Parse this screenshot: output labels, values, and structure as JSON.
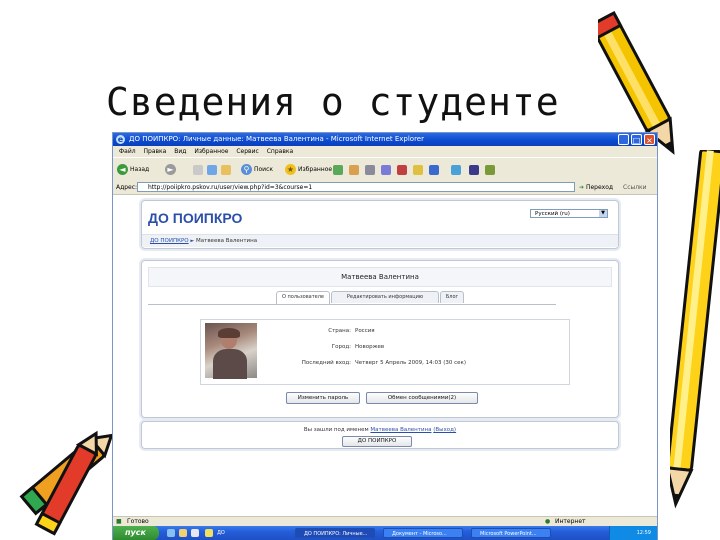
{
  "slide": {
    "title": "Сведения о студенте"
  },
  "window": {
    "title": "ДО ПОИПКРО: Личные данные: Матвеева Валентина - Microsoft Internet Explorer"
  },
  "menu": [
    "Файл",
    "Правка",
    "Вид",
    "Избранное",
    "Сервис",
    "Справка"
  ],
  "toolbar": {
    "back": "Назад",
    "search": "Поиск",
    "favorites": "Избранное"
  },
  "address": {
    "label": "Адрес:",
    "url": "http://poiipkro.pskov.ru/user/view.php?id=3&course=1",
    "go": "Переход",
    "links": "Ссылки"
  },
  "site": {
    "title": "ДО ПОИПКРО",
    "language": "Русский (ru)",
    "breadcrumb": {
      "home": "ДО ПОИПКРО",
      "separator": "►",
      "current": "Матвеева Валентина"
    }
  },
  "profile": {
    "name": "Матвеева Валентина",
    "tabs": [
      "О пользователе",
      "Редактировать информацию",
      "Блог"
    ],
    "fields": [
      {
        "label": "Страна:",
        "value": "Россия"
      },
      {
        "label": "Город:",
        "value": "Новоржев"
      },
      {
        "label": "Последний вход:",
        "value": "Четверг 5 Апрель 2009, 14:03  (30 сек)"
      }
    ],
    "buttons": {
      "change_password": "Изменить пароль",
      "messages": "Обмен сообщениями(2)"
    }
  },
  "footer": {
    "prefix": "Вы зашли под именем",
    "user": "Матвеева Валентина",
    "logout": "(Выход)",
    "home_button": "ДО ПОИПКРО"
  },
  "status": {
    "text": "Готово",
    "zone": "Интернет"
  },
  "taskbar": {
    "start": "пуск",
    "tasks": [
      "ДО ПОИПКРО: Личные...",
      "Документ - Microso...",
      "Microsoft PowerPoint..."
    ],
    "quick": "ДО",
    "clock": "12:59"
  },
  "colors": {
    "accent": "#2b4fa8",
    "titlebar": "#0a49d0",
    "start": "#3c9a3c"
  }
}
